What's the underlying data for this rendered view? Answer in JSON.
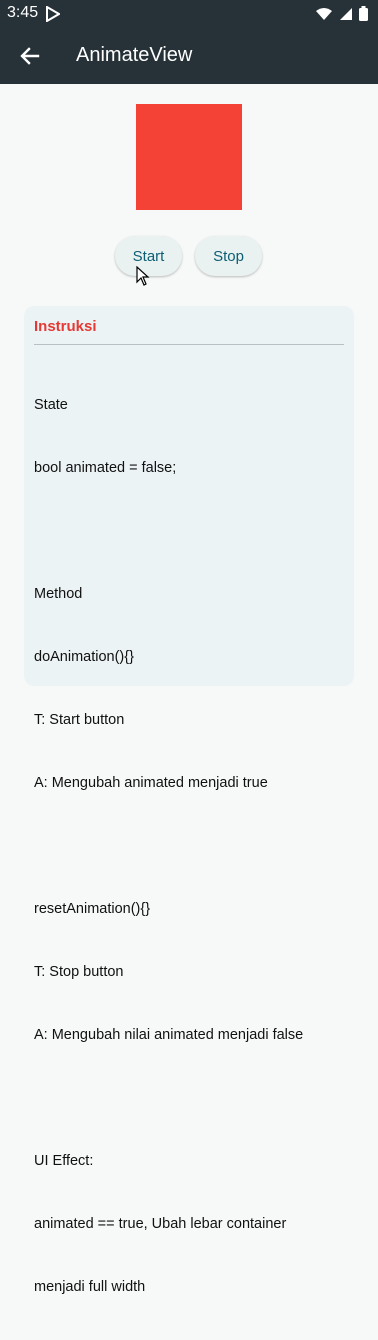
{
  "status_bar": {
    "time": "3:45"
  },
  "app_bar": {
    "title": "AnimateView"
  },
  "animated_box": {
    "color": "#f44336"
  },
  "buttons": {
    "start_label": "Start",
    "stop_label": "Stop"
  },
  "instructions": {
    "title": "Instruksi",
    "lines": [
      "State",
      "bool animated = false;",
      "",
      "Method",
      "doAnimation(){}",
      "T: Start button",
      "A: Mengubah animated menjadi true",
      "",
      "resetAnimation(){}",
      "T: Stop button",
      "A: Mengubah nilai animated menjadi false",
      "",
      "UI Effect:",
      "animated == true, Ubah lebar container",
      "menjadi full width"
    ]
  }
}
